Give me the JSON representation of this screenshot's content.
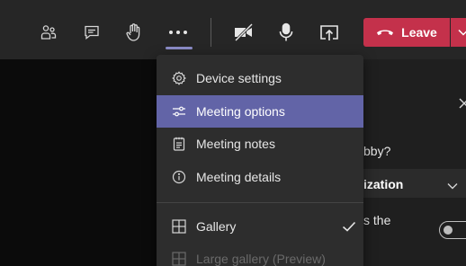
{
  "toolbar": {
    "buttons": [
      {
        "name": "participants",
        "icon": "people-icon"
      },
      {
        "name": "chat",
        "icon": "chat-icon"
      },
      {
        "name": "raise-hand",
        "icon": "hand-icon"
      },
      {
        "name": "more-actions",
        "icon": "ellipsis-icon"
      },
      {
        "name": "camera",
        "icon": "camera-off-icon"
      },
      {
        "name": "microphone",
        "icon": "microphone-icon"
      },
      {
        "name": "share",
        "icon": "share-screen-icon"
      }
    ],
    "leave_label": "Leave",
    "leave_color": "#c4314b",
    "accent_color": "#6264a7"
  },
  "menu": {
    "items": [
      {
        "label": "Device settings",
        "icon": "gear-icon"
      },
      {
        "label": "Meeting options",
        "icon": "sliders-icon",
        "highlighted": true
      },
      {
        "label": "Meeting notes",
        "icon": "notes-icon"
      },
      {
        "label": "Meeting details",
        "icon": "info-icon"
      }
    ],
    "views": [
      {
        "label": "Gallery",
        "icon": "grid-icon",
        "checked": true
      },
      {
        "label": "Large gallery (Preview)",
        "icon": "grid-icon",
        "disabled": true
      }
    ]
  },
  "side_panel": {
    "question_fragment": "bby?",
    "section_fragment": "ization",
    "row_fragment": "s the"
  }
}
